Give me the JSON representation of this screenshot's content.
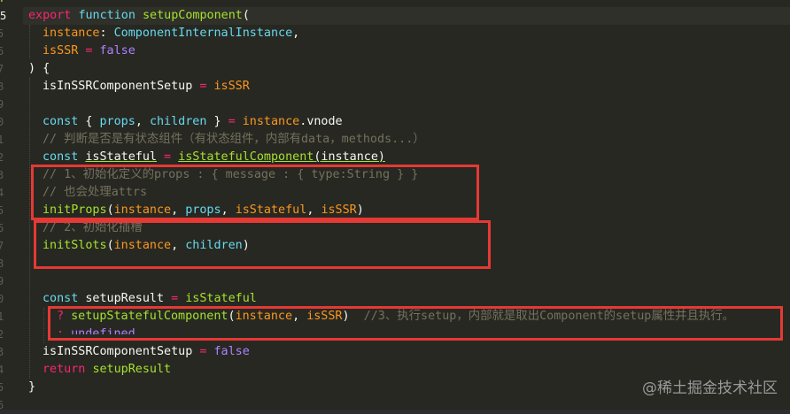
{
  "gutter": {
    "numbers": [
      "4",
      "5",
      "5",
      "6",
      "7",
      "8",
      "9",
      "0",
      "1",
      "2",
      "3",
      "4",
      "5",
      "6",
      "7",
      "8",
      "9",
      "0",
      "1",
      "2",
      "3",
      "4",
      "5",
      "6"
    ],
    "active_label": "5"
  },
  "code": {
    "l01": {
      "kw": "export",
      "sto": "function",
      "fn": "setupComponent",
      "p": "("
    },
    "l02": {
      "param": "instance",
      "colon": ": ",
      "type": "ComponentInternalInstance",
      "comma": ","
    },
    "l03": {
      "param": "isSSR",
      "eq": " = ",
      "val": "false"
    },
    "l04": {
      "text": ") {"
    },
    "l05": {
      "var": "isInSSRComponentSetup",
      "eq": " = ",
      "ref": "isSSR"
    },
    "l07": {
      "kw": "const",
      "b1": " { ",
      "v1": "props",
      "c": ", ",
      "v2": "children",
      "b2": " } ",
      "eq": "= ",
      "obj": "instance",
      "dot": ".",
      "prop": "vnode"
    },
    "l08": {
      "comment": "// 判断是否是有状态组件（有状态组件，内部有data，methods...）"
    },
    "l09": {
      "kw": "const",
      "var": "isStateful",
      "eq": " = ",
      "fn": "isStatefulComponent",
      "args": "(instance)"
    },
    "l10": {
      "comment": "// 1、初始化定义的props : { message : { type:String } }"
    },
    "l11": {
      "comment": "// 也会处理attrs"
    },
    "l12": {
      "fn": "initProps",
      "p1": "(",
      "a1": "instance",
      "c1": ", ",
      "a2": "props",
      "c2": ", ",
      "a3": "isStateful",
      "c3": ", ",
      "a4": "isSSR",
      "p2": ")"
    },
    "l13": {
      "comment": "// 2、初始化插槽"
    },
    "l14": {
      "fn": "initSlots",
      "p1": "(",
      "a1": "instance",
      "c1": ", ",
      "a2": "children",
      "p2": ")"
    },
    "l17": {
      "kw": "const",
      "var": "setupResult",
      "eq": " = ",
      "ref": "isStateful"
    },
    "l18": {
      "op": "? ",
      "fn": "setupStatefulComponent",
      "p1": "(",
      "a1": "instance",
      "c1": ", ",
      "a2": "isSSR",
      "p2": ")",
      "comment": "  //3、执行setup，内部就是取出Component的setup属性并且执行。"
    },
    "l19": {
      "op": ": ",
      "val": "undefined"
    },
    "l20": {
      "var": "isInSSRComponentSetup",
      "eq": " = ",
      "val": "false"
    },
    "l21": {
      "kw": "return",
      "ref": "setupResult"
    },
    "l22": {
      "text": "}"
    }
  },
  "watermark": "@稀土掘金技术社区",
  "colors": {
    "background": "#272822",
    "highlight_box": "#e53935",
    "keyword": "#f92672",
    "function": "#a6e22e",
    "parameter": "#fd971f",
    "type": "#66d9ef",
    "constant": "#ae81ff",
    "comment": "#75715e"
  }
}
